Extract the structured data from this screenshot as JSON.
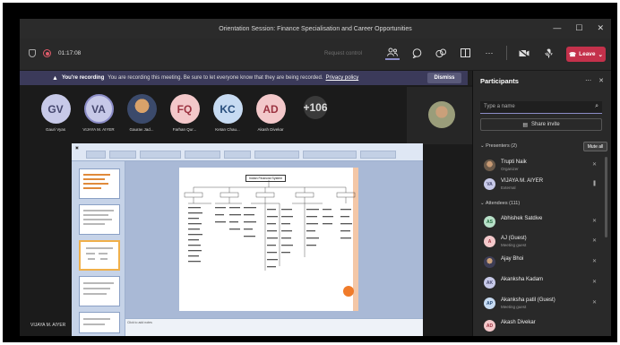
{
  "window": {
    "title": "Orientation Session: Finance Specialisation and Career Opportunities",
    "controls": [
      "—",
      "☐",
      "✕"
    ]
  },
  "toolbar": {
    "timer": "01:17:08",
    "request_control": "Request control",
    "leave_label": "Leave"
  },
  "banner": {
    "bold": "You're recording",
    "text": "You are recording this meeting. Be sure to let everyone know that they are being recorded.",
    "link": "Privacy policy",
    "dismiss": "Dismiss"
  },
  "avatars": [
    {
      "initials": "GV",
      "name": "Gauri Vyas"
    },
    {
      "initials": "VA",
      "name": "VIJAYA M. AIYER"
    },
    {
      "initials": "",
      "name": "Gaurav Jad..."
    },
    {
      "initials": "FQ",
      "name": "Farhan Qur..."
    },
    {
      "initials": "KC",
      "name": "Ketan Chau..."
    },
    {
      "initials": "AD",
      "name": "Akash Divekar"
    },
    {
      "initials": "+106",
      "name": ""
    }
  ],
  "share": {
    "presenter": "VIJAYA M. AIYER",
    "slide_title": "Indian Financial System",
    "notes_hint": "Click to add notes"
  },
  "panel": {
    "title": "Participants",
    "search_placeholder": "Type a name",
    "share_invite": "Share invite",
    "presenters_heading": "Presenters (2)",
    "mute_all": "Mute all",
    "attendees_heading": "Attendees (111)",
    "presenters": [
      {
        "name": "Trupti Naik",
        "role": "Organizer",
        "initials": ""
      },
      {
        "name": "VIJAYA M. AIYER",
        "role": "External",
        "initials": "VA"
      }
    ],
    "attendees": [
      {
        "name": "Abhishek Satdive",
        "role": "",
        "initials": "AS"
      },
      {
        "name": "AJ (Guest)",
        "role": "Meeting guest",
        "initials": "A"
      },
      {
        "name": "Ajay Bhoi",
        "role": "",
        "initials": ""
      },
      {
        "name": "Akanksha Kadam",
        "role": "",
        "initials": "AK"
      },
      {
        "name": "Akanksha patil (Guest)",
        "role": "Meeting guest",
        "initials": "AP"
      },
      {
        "name": "Akash Divekar",
        "role": "",
        "initials": "AD"
      }
    ]
  },
  "colors": {
    "accent": "#8b8cc7",
    "leave": "#c4314b",
    "banner": "#3b3a5a"
  }
}
